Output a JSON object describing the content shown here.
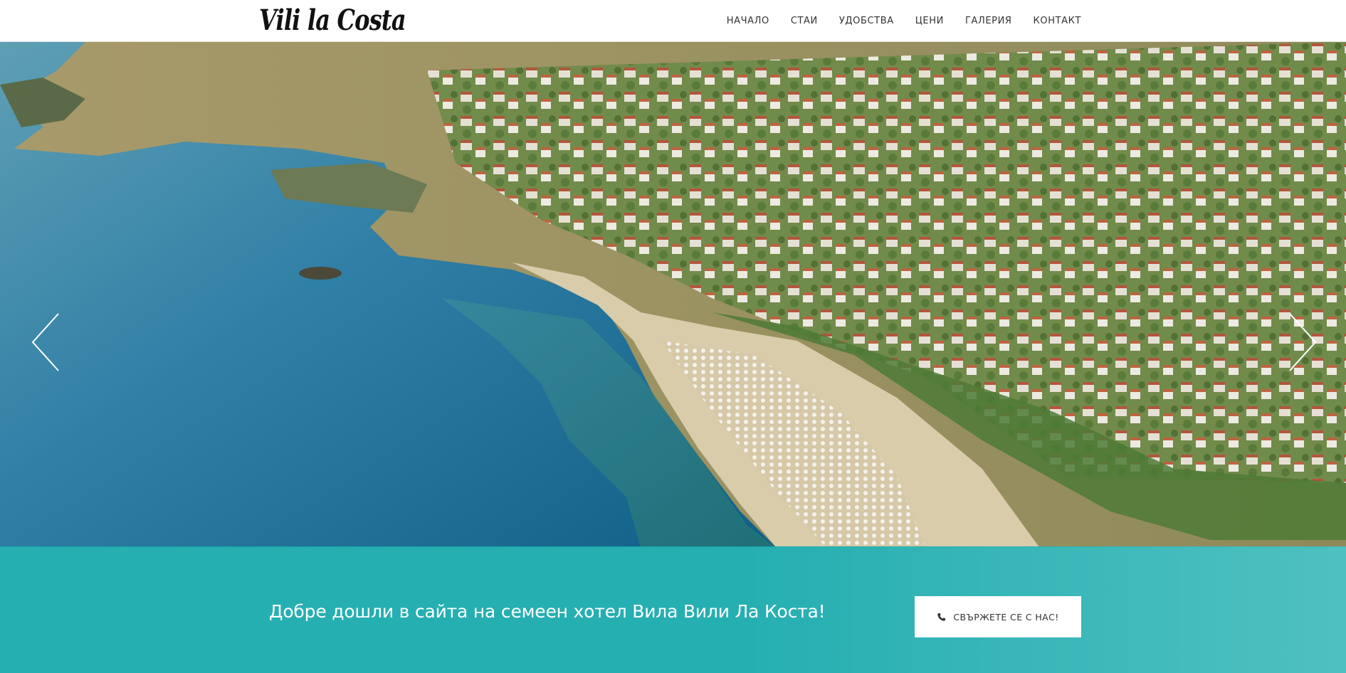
{
  "brand": {
    "logo_text": "Vili la Costa"
  },
  "nav": {
    "items": [
      {
        "label": "НАЧАЛО"
      },
      {
        "label": "СТАИ"
      },
      {
        "label": "УДОБСТВА"
      },
      {
        "label": "ЦЕНИ"
      },
      {
        "label": "ГАЛЕРИЯ"
      },
      {
        "label": "КОНТАКТ"
      }
    ]
  },
  "hero": {
    "image": "aerial-coastal-town-beach-photo",
    "prev_icon": "chevron-left-icon",
    "next_icon": "chevron-right-icon"
  },
  "welcome": {
    "text": "Добре дошли в сайта на семеен хотел Вила Вили Ла Коста!",
    "cta_label": "СВЪРЖЕТЕ СЕ С НАС!",
    "cta_icon": "phone-icon"
  },
  "colors": {
    "band": "#14a8aa",
    "header_bg": "#ffffff",
    "nav_text": "#333333"
  }
}
